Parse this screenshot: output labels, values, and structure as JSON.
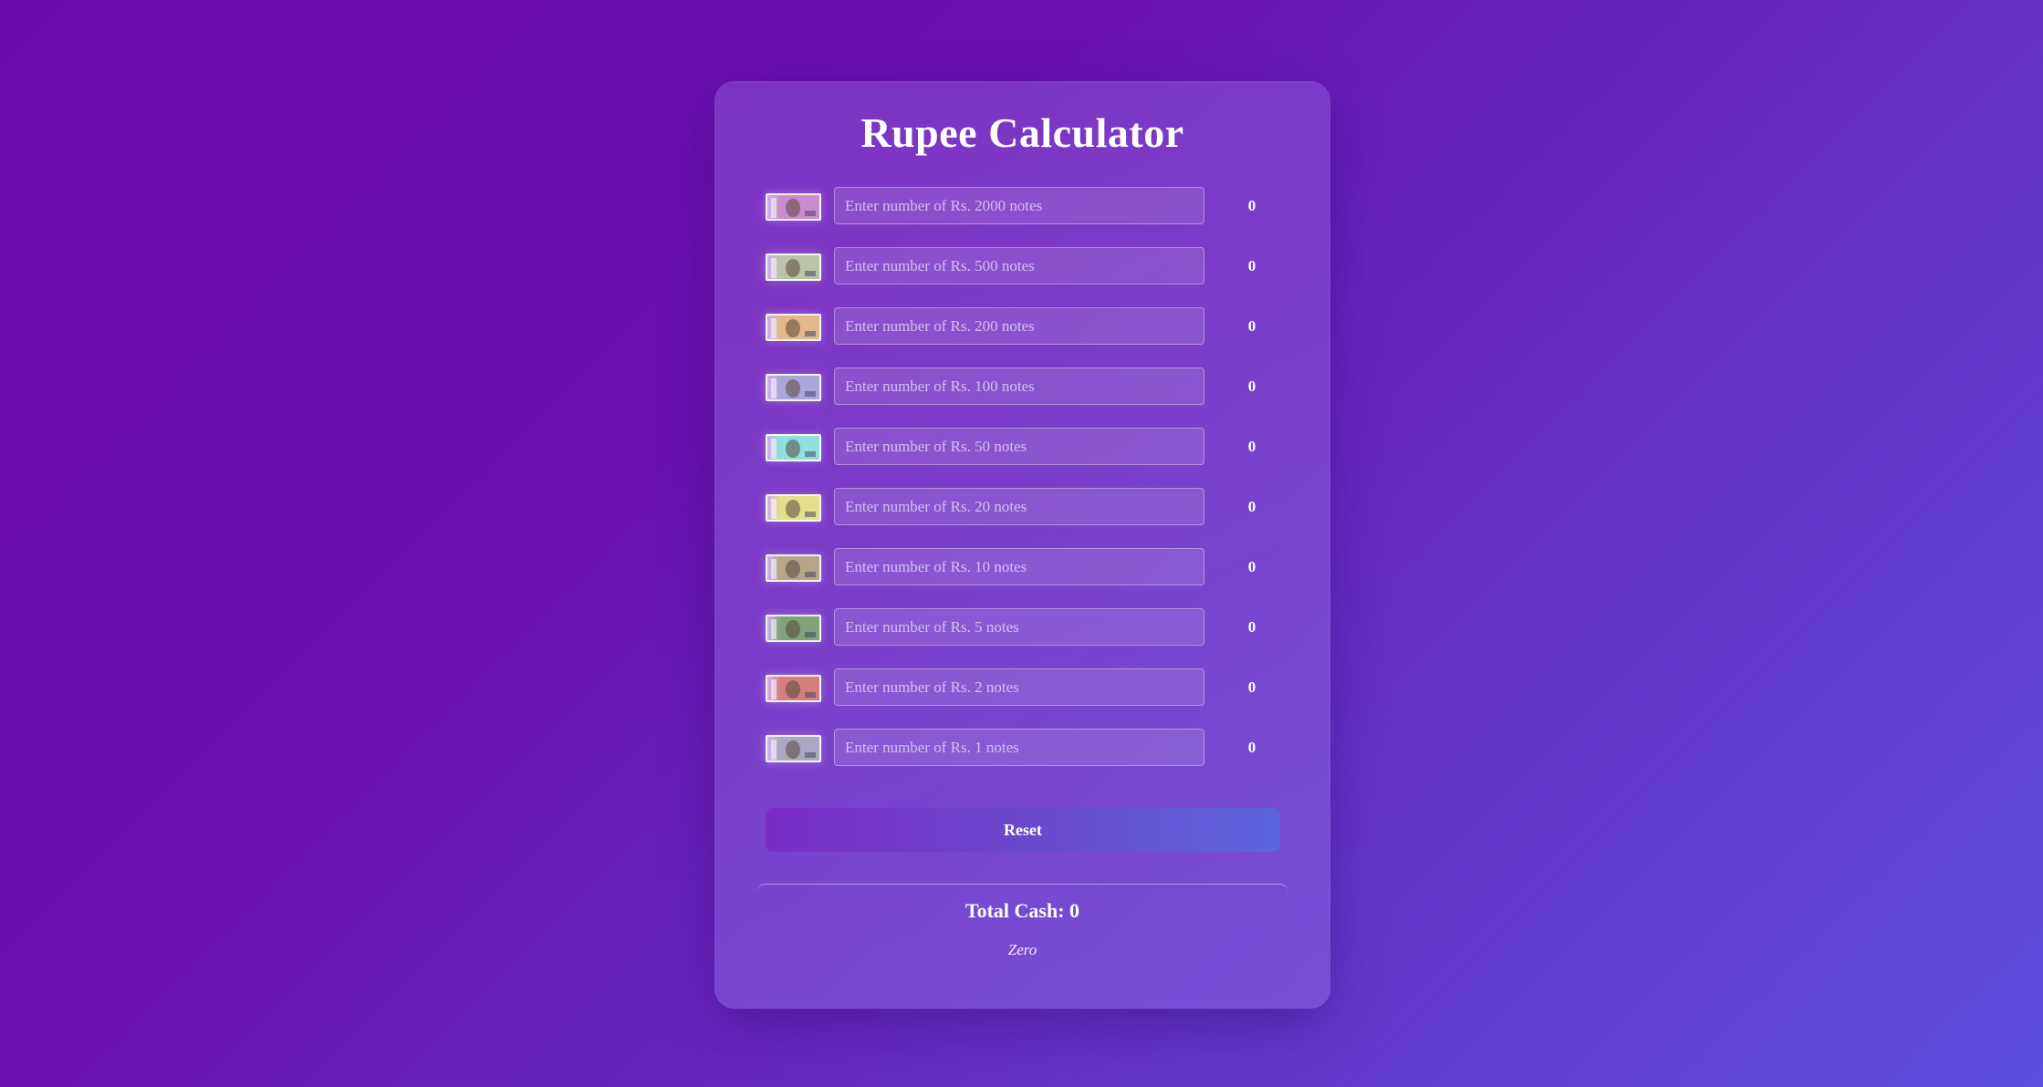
{
  "app": {
    "title": "Rupee Calculator"
  },
  "denominations": [
    {
      "note": "2000",
      "placeholder": "Enter number of Rs. 2000 notes",
      "amount": "0",
      "note_color": "#c98ccf",
      "icon": "rs-2000-note-icon"
    },
    {
      "note": "500",
      "placeholder": "Enter number of Rs. 500 notes",
      "amount": "0",
      "note_color": "#b9c4a8",
      "icon": "rs-500-note-icon"
    },
    {
      "note": "200",
      "placeholder": "Enter number of Rs. 200 notes",
      "amount": "0",
      "note_color": "#e2b98c",
      "icon": "rs-200-note-icon"
    },
    {
      "note": "100",
      "placeholder": "Enter number of Rs. 100 notes",
      "amount": "0",
      "note_color": "#a9a6dc",
      "icon": "rs-100-note-icon"
    },
    {
      "note": "50",
      "placeholder": "Enter number of Rs. 50 notes",
      "amount": "0",
      "note_color": "#8fe0df",
      "icon": "rs-50-note-icon"
    },
    {
      "note": "20",
      "placeholder": "Enter number of Rs. 20 notes",
      "amount": "0",
      "note_color": "#e4e08a",
      "icon": "rs-20-note-icon"
    },
    {
      "note": "10",
      "placeholder": "Enter number of Rs. 10 notes",
      "amount": "0",
      "note_color": "#b8a487",
      "icon": "rs-10-note-icon"
    },
    {
      "note": "5",
      "placeholder": "Enter number of Rs. 5 notes",
      "amount": "0",
      "note_color": "#7fa37a",
      "icon": "rs-5-note-icon"
    },
    {
      "note": "2",
      "placeholder": "Enter number of Rs. 2 notes",
      "amount": "0",
      "note_color": "#d2807e",
      "icon": "rs-2-note-icon"
    },
    {
      "note": "1",
      "placeholder": "Enter number of Rs. 1 notes",
      "amount": "0",
      "note_color": "#a9a8c0",
      "icon": "rs-1-note-icon"
    }
  ],
  "actions": {
    "reset_label": "Reset"
  },
  "summary": {
    "total_label": "Total Cash: 0",
    "total_words": "Zero"
  }
}
